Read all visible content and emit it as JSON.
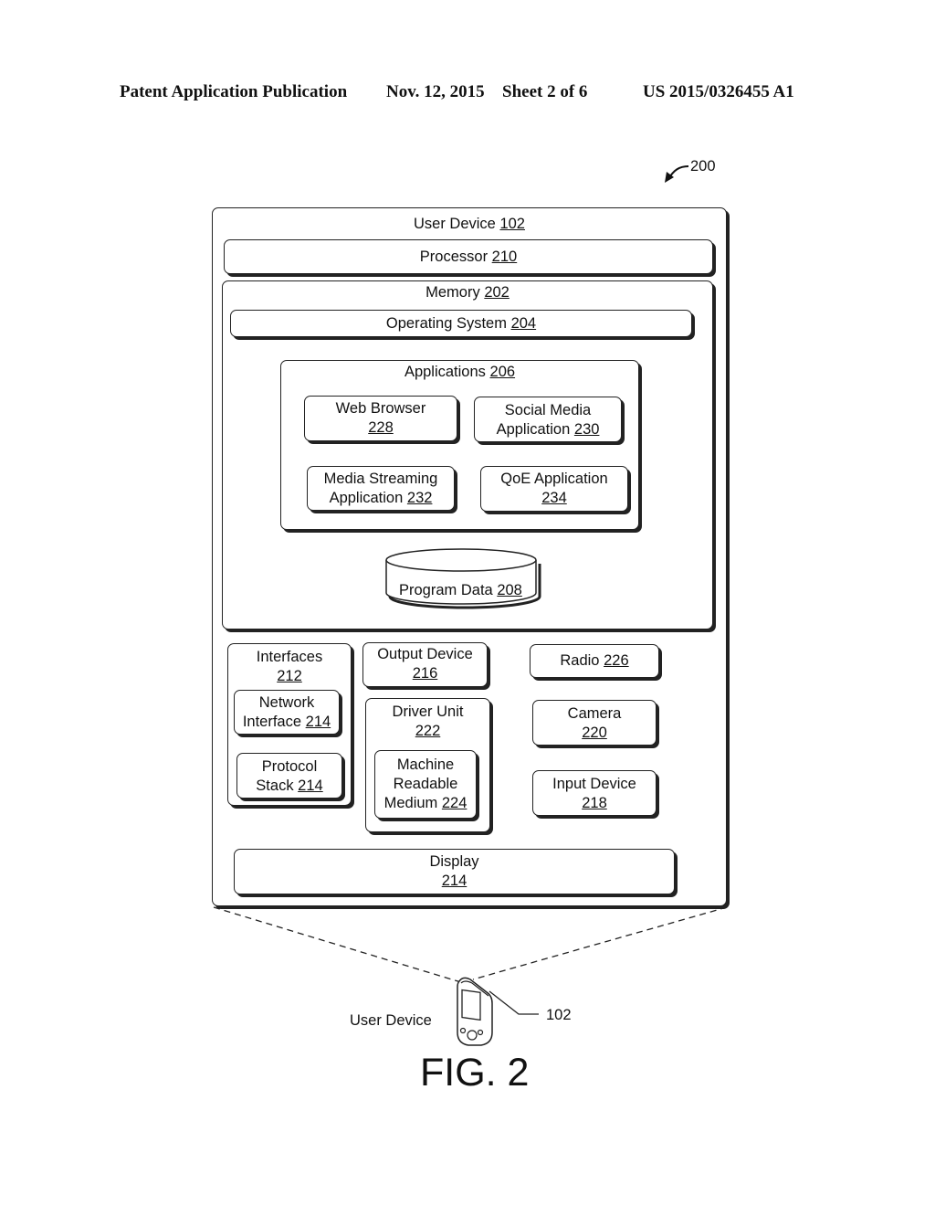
{
  "header": {
    "publication": "Patent Application Publication",
    "date": "Nov. 12, 2015",
    "sheet": "Sheet 2 of 6",
    "number": "US 2015/0326455 A1"
  },
  "figure_ref": "200",
  "user_device": {
    "label": "User Device",
    "num": "102"
  },
  "processor": {
    "label": "Processor",
    "num": "210"
  },
  "memory": {
    "label": "Memory",
    "num": "202"
  },
  "operating_system": {
    "label": "Operating System",
    "num": "204"
  },
  "applications": {
    "label": "Applications",
    "num": "206",
    "items": [
      {
        "line1": "Web Browser",
        "line2": "",
        "num": "228"
      },
      {
        "line1": "Social Media",
        "line2": "Application",
        "num": "230"
      },
      {
        "line1": "Media Streaming",
        "line2": "Application",
        "num": "232"
      },
      {
        "line1": "QoE Application",
        "line2": "",
        "num": "234"
      }
    ]
  },
  "program_data": {
    "label": "Program Data",
    "num": "208"
  },
  "interfaces": {
    "line1": "Interfaces",
    "num": "212",
    "network": {
      "line1": "Network",
      "line2": "Interface",
      "num": "214"
    },
    "protocol": {
      "line1": "Protocol",
      "line2": "Stack",
      "num": "214"
    }
  },
  "output_device": {
    "line1": "Output Device",
    "num": "216"
  },
  "driver_unit": {
    "line1": "Driver Unit",
    "num": "222",
    "medium": {
      "line1": "Machine",
      "line2": "Readable",
      "line3": "Medium",
      "num": "224"
    }
  },
  "radio": {
    "label": "Radio",
    "num": "226"
  },
  "camera": {
    "line1": "Camera",
    "num": "220"
  },
  "input_device": {
    "line1": "Input Device",
    "num": "218"
  },
  "display": {
    "line1": "Display",
    "num": "214"
  },
  "device_caption": "User Device",
  "device_ref": "102",
  "figure_label": "FIG. 2"
}
